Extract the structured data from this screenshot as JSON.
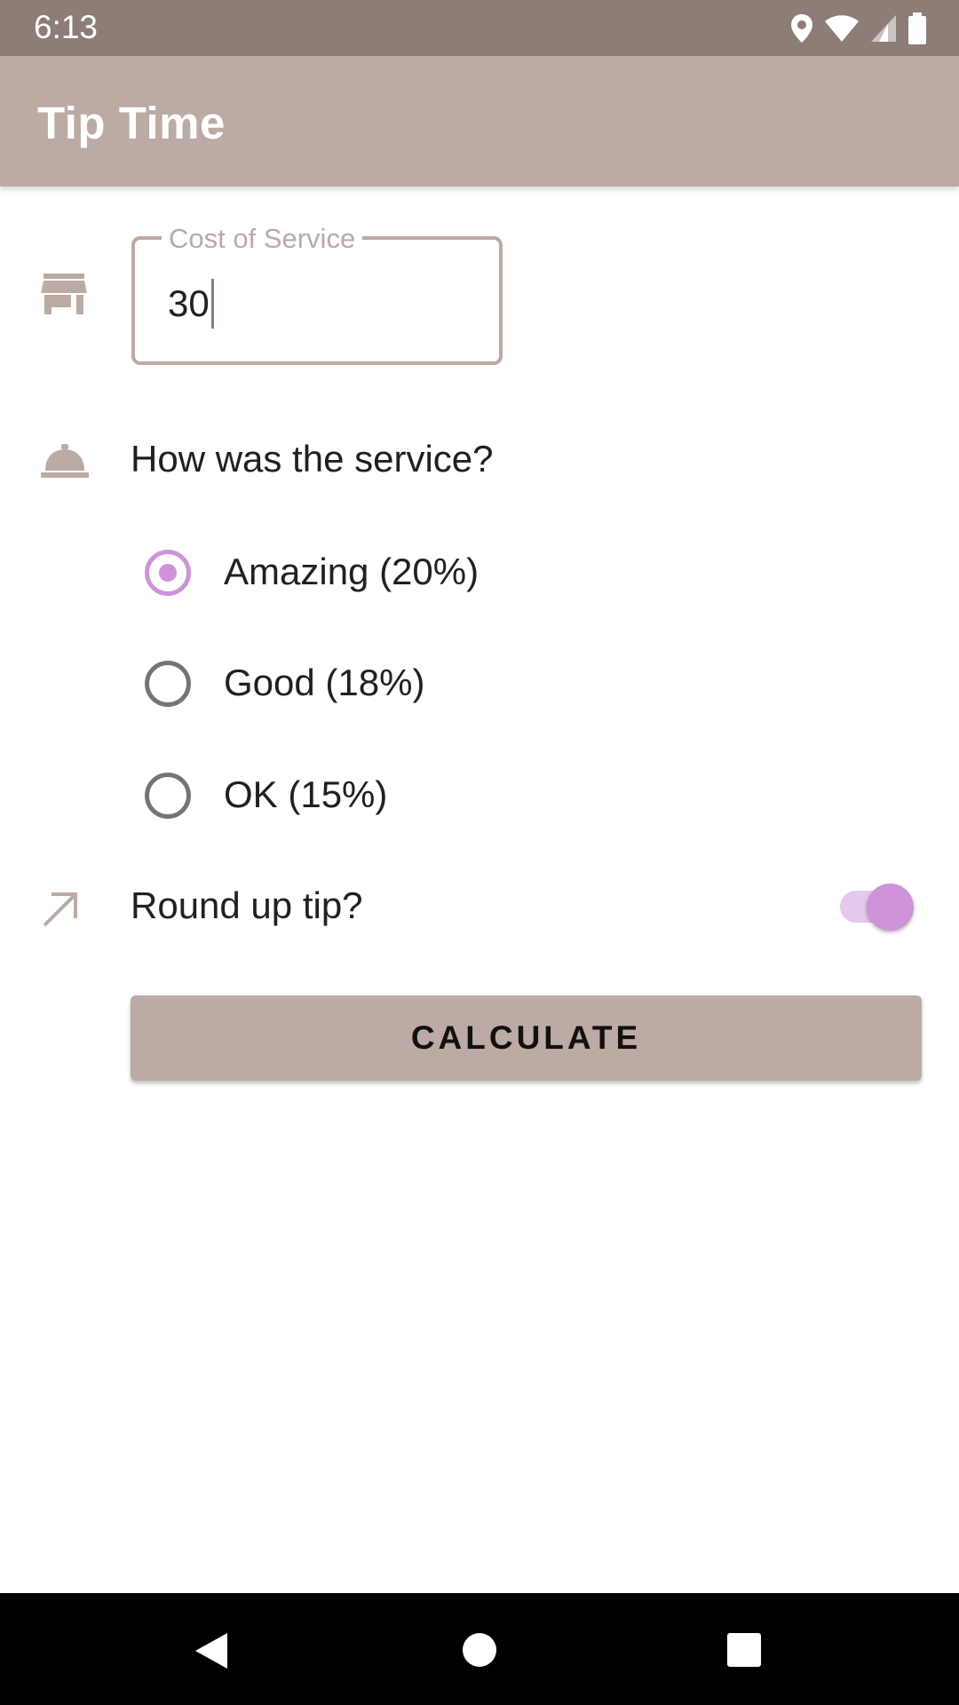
{
  "status_bar": {
    "time": "6:13",
    "icons": [
      "location-icon",
      "wifi-icon",
      "signal-icon",
      "battery-icon"
    ]
  },
  "app_bar": {
    "title": "Tip Time"
  },
  "cost_field": {
    "label": "Cost of Service",
    "value": "30",
    "icon": "store-icon"
  },
  "service": {
    "question": "How was the service?",
    "icon": "room-service-icon",
    "options": [
      {
        "label": "Amazing (20%)",
        "checked": true
      },
      {
        "label": "Good (18%)",
        "checked": false
      },
      {
        "label": "OK (15%)",
        "checked": false
      }
    ]
  },
  "round_up": {
    "label": "Round up tip?",
    "icon": "round-up-arrow-icon",
    "enabled": true
  },
  "calculate_button": {
    "label": "CALCULATE"
  },
  "colors": {
    "primary": "#bcaaa4",
    "primary_dark": "#8e7c76",
    "accent": "#ce93d8"
  },
  "nav_bar": {
    "buttons": [
      "back-icon",
      "home-icon",
      "recents-icon"
    ]
  }
}
